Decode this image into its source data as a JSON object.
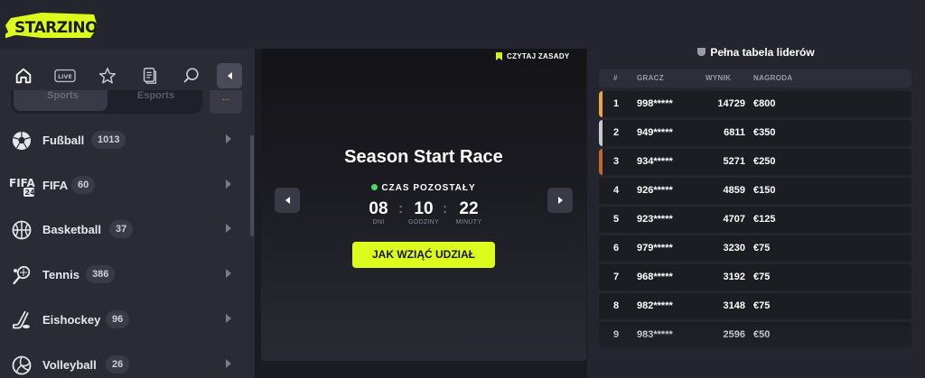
{
  "brand": {
    "logo_text": "STARZINO",
    "accent_color": "#dcfc1e"
  },
  "sidebar": {
    "top_icons": [
      {
        "name": "home-icon"
      },
      {
        "name": "live-icon",
        "label": "LIVE"
      },
      {
        "name": "star-icon"
      },
      {
        "name": "betslip-icon"
      },
      {
        "name": "search-icon"
      }
    ],
    "segments": [
      {
        "label": "Sports",
        "active": true
      },
      {
        "label": "Esports",
        "active": false
      }
    ],
    "segment_extra": "...",
    "sports": [
      {
        "name": "Fußball",
        "count": "1013",
        "icon": "football-icon"
      },
      {
        "name": "FIFA",
        "count": "60",
        "icon": "fifa-icon"
      },
      {
        "name": "Basketball",
        "count": "37",
        "icon": "basketball-icon"
      },
      {
        "name": "Tennis",
        "count": "386",
        "icon": "tennis-icon"
      },
      {
        "name": "Eishockey",
        "count": "96",
        "icon": "hockey-icon"
      },
      {
        "name": "Volleyball",
        "count": "26",
        "icon": "volleyball-icon"
      }
    ]
  },
  "race": {
    "rules_link": "CZYTAJ ZASADY",
    "title": "Season Start Race",
    "remaining_label": "CZAS POZOSTAŁY",
    "countdown": [
      {
        "value": "08",
        "label": "DNI"
      },
      {
        "value": "10",
        "label": "GODZINY"
      },
      {
        "value": "22",
        "label": "MINUTY"
      }
    ],
    "separator": ":",
    "join_button": "JAK WZIĄĆ UDZIAŁ"
  },
  "leaderboard": {
    "title": "Pełna tabela liderów",
    "columns": {
      "rank": "#",
      "player": "GRACZ",
      "score": "WYNIK",
      "prize": "NAGRODA"
    },
    "rows": [
      {
        "rank": "1",
        "player": "998*****",
        "score": "14729",
        "prize": "€800",
        "accent": "#e8a93a"
      },
      {
        "rank": "2",
        "player": "949*****",
        "score": "6811",
        "prize": "€350",
        "accent": "#c8c8d0"
      },
      {
        "rank": "3",
        "player": "934*****",
        "score": "5271",
        "prize": "€250",
        "accent": "#c0682c"
      },
      {
        "rank": "4",
        "player": "926*****",
        "score": "4859",
        "prize": "€150",
        "accent": ""
      },
      {
        "rank": "5",
        "player": "923*****",
        "score": "4707",
        "prize": "€125",
        "accent": ""
      },
      {
        "rank": "6",
        "player": "979*****",
        "score": "3230",
        "prize": "€75",
        "accent": ""
      },
      {
        "rank": "7",
        "player": "968*****",
        "score": "3192",
        "prize": "€75",
        "accent": ""
      },
      {
        "rank": "8",
        "player": "982*****",
        "score": "3148",
        "prize": "€75",
        "accent": ""
      },
      {
        "rank": "9",
        "player": "983*****",
        "score": "2596",
        "prize": "€50",
        "accent": ""
      }
    ]
  }
}
